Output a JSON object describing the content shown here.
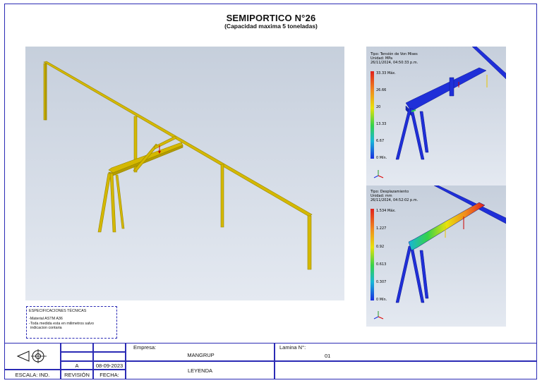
{
  "drawing": {
    "title": "SEMIPORTICO N°26",
    "subtitle": "(Capacidad maxima 5 toneladas)"
  },
  "stress_view": {
    "type_label": "Tipo: Tensión de Von Mises",
    "unit_label": "Unidad: MPa",
    "timestamp": "26/11/2024, 04:50:33 p.m.",
    "scale": [
      "33.33 Máx.",
      "26.66",
      "20",
      "13.33",
      "6.67",
      "0 Mín."
    ]
  },
  "displacement_view": {
    "type_label": "Tipo: Desplazamiento",
    "unit_label": "Unidad: mm",
    "timestamp": "26/11/2024, 04:52:02 p.m.",
    "scale": [
      "1.534 Máx.",
      "1.227",
      "0.92",
      "0.613",
      "0.307",
      "0 Mín."
    ]
  },
  "specs": {
    "title": "ESPECIFICACIONES TÉCNICAS",
    "line1": "-Material ASTM A36",
    "line2": "-Toda medida esta en milimetros salvo",
    "line3": "indicacion contaria"
  },
  "title_block": {
    "empresa_label": "Empresa:",
    "empresa_value": "MANGRUP",
    "lamina_label": "Lamina N°:",
    "lamina_value": "01",
    "leyenda": "LEYENDA",
    "revision_value": "A",
    "fecha_value": "08-09-2023",
    "escala_label": "ESCALA:  IND.",
    "revision_label": "REVISIÓN",
    "fecha_label": "FECHA:"
  },
  "colors": {
    "border": "#2b2bb5",
    "model_yellow": "#d4b800",
    "viewport_bg": "#cfd8e6"
  }
}
